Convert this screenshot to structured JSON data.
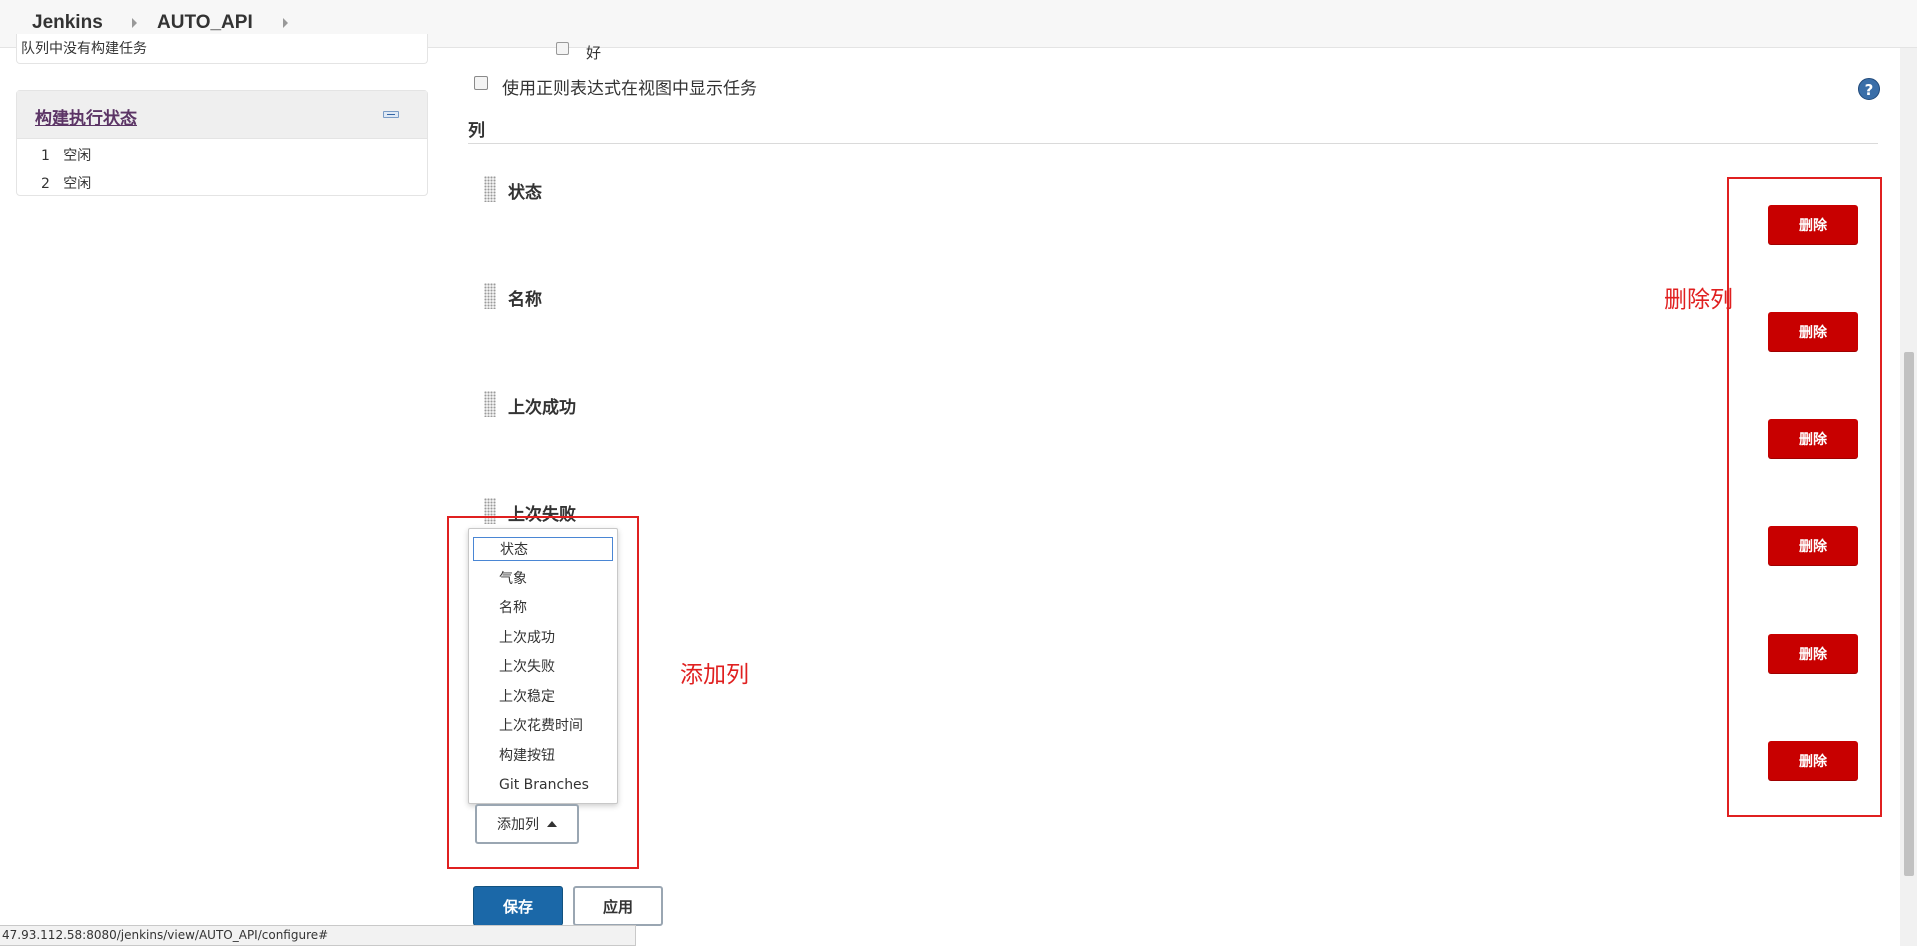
{
  "breadcrumb": {
    "items": [
      "Jenkins",
      "AUTO_API"
    ]
  },
  "sidebar": {
    "queue_text": "队列中没有构建任务",
    "executor_title": "构建执行状态",
    "executors": [
      {
        "number": "1",
        "status": "空闲"
      },
      {
        "number": "2",
        "status": "空闲"
      }
    ]
  },
  "options": {
    "partial_label": "好",
    "regex_label": "使用正则表达式在视图中显示任务"
  },
  "columns_section": {
    "title": "列",
    "items": [
      "状态",
      "名称",
      "上次成功",
      "上次失败"
    ],
    "delete_label": "删除"
  },
  "dropdown": {
    "items": [
      "状态",
      "气象",
      "名称",
      "上次成功",
      "上次失败",
      "上次稳定",
      "上次花费时间",
      "构建按钮",
      "Git Branches"
    ],
    "selected_index": 0
  },
  "annotations": {
    "delete_columns": "删除列",
    "add_columns": "添加列"
  },
  "buttons": {
    "add_column": "添加列",
    "save": "保存",
    "apply": "应用"
  },
  "status_url": "47.93.112.58:8080/jenkins/view/AUTO_API/configure#",
  "help_icon": "question-circle-icon",
  "colors": {
    "delete_red": "#c80000",
    "save_blue": "#1b68a8",
    "annotation_red": "#e02020",
    "link_purple": "#5c3566"
  }
}
